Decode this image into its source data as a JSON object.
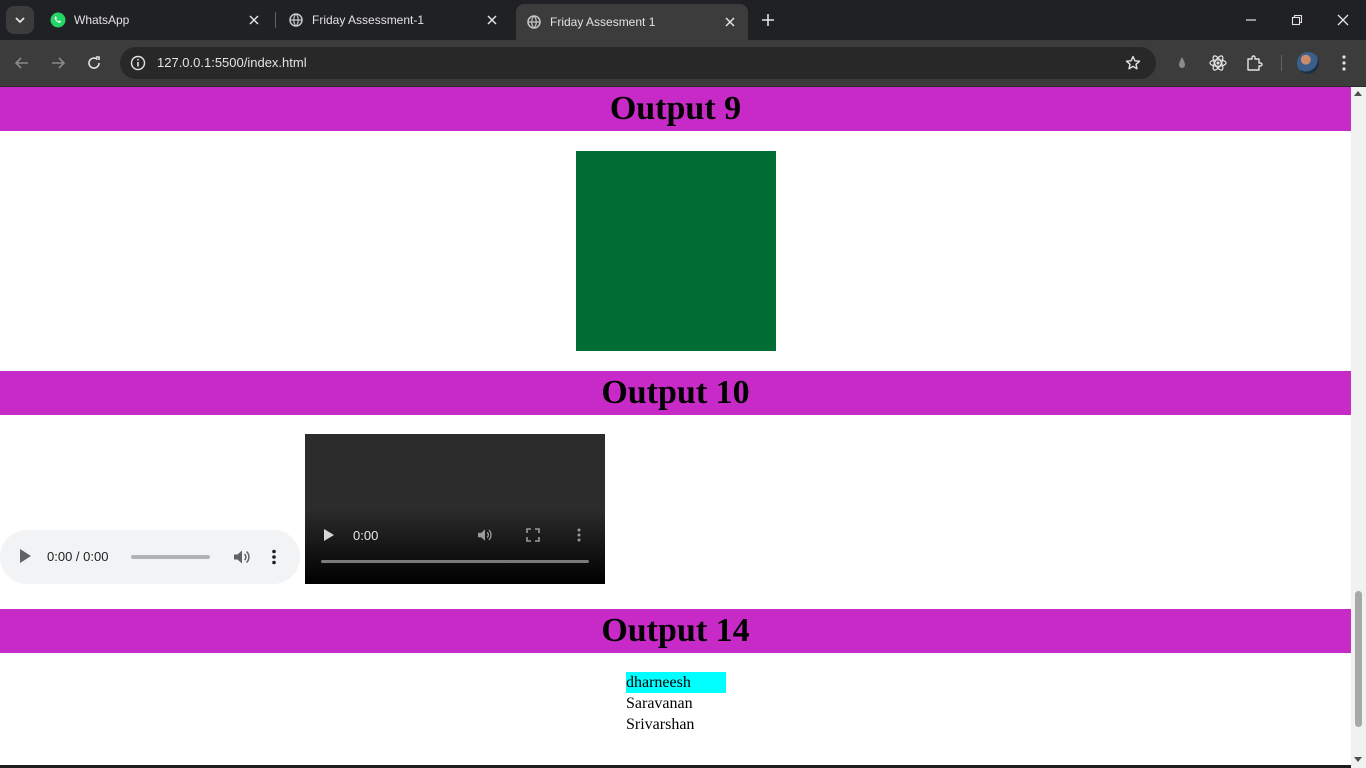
{
  "browser": {
    "tabs": [
      {
        "title": "WhatsApp",
        "icon": "whatsapp-icon",
        "active": false
      },
      {
        "title": "Friday Assessment-1",
        "icon": "globe-icon",
        "active": false
      },
      {
        "title": "Friday Assesment 1",
        "icon": "globe-icon",
        "active": true
      }
    ],
    "url": "127.0.0.1:5500/index.html"
  },
  "page": {
    "sections": [
      {
        "heading": "Output 9",
        "heading_bg": "#c82ac8"
      },
      {
        "heading": "Output 10",
        "heading_bg": "#c82ac8"
      },
      {
        "heading": "Output 14",
        "heading_bg": "#c82ac8"
      }
    ],
    "green_box_color": "#006d33",
    "audio_player": {
      "time": "0:00 / 0:00"
    },
    "video_player": {
      "time": "0:00"
    },
    "names": [
      "dharneesh",
      "Saravanan",
      "Srivarshan"
    ],
    "highlight_color": "#00ffff"
  }
}
